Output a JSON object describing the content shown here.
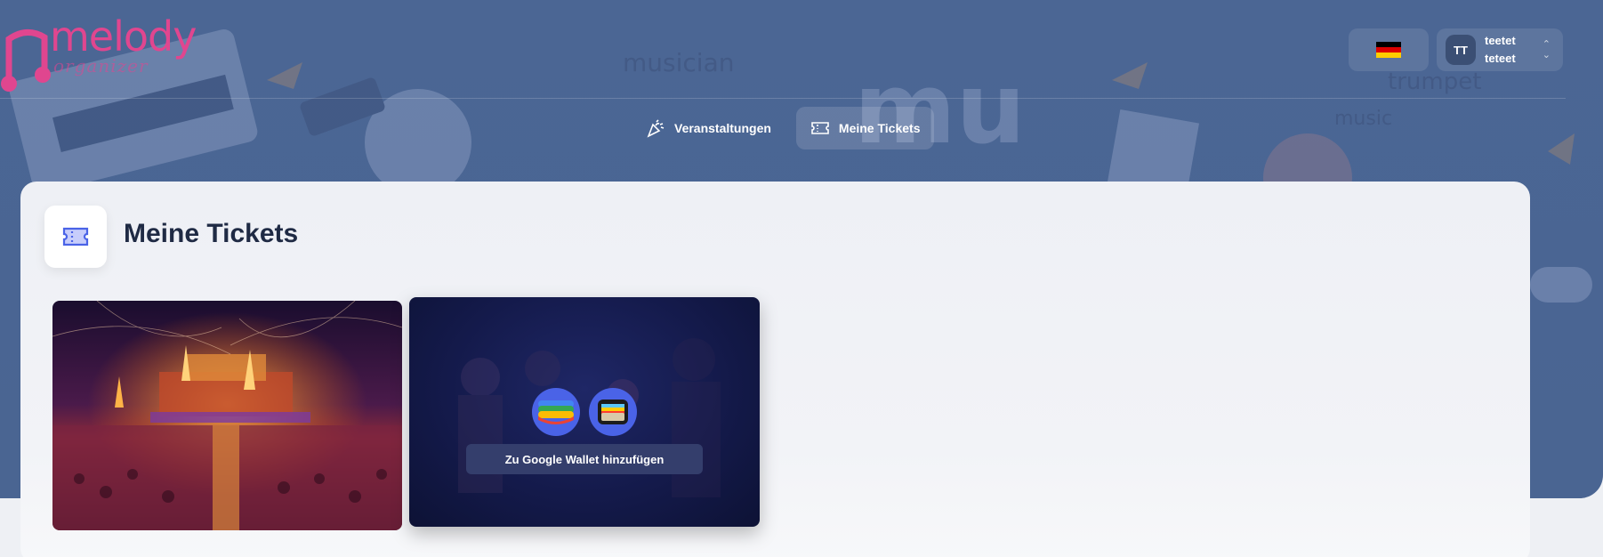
{
  "brand": {
    "name": "melody",
    "subtitle": "organizer"
  },
  "header": {
    "language": {
      "flag_colors": [
        "#000000",
        "#dd0000",
        "#ffce00"
      ]
    },
    "user": {
      "initials": "TT",
      "first_name": "teetet",
      "last_name": "teteet"
    }
  },
  "nav": {
    "items": [
      {
        "label": "Veranstaltungen",
        "icon": "party-popper-icon",
        "active": false
      },
      {
        "label": "Meine Tickets",
        "icon": "ticket-icon",
        "active": true
      }
    ]
  },
  "main": {
    "title": "Meine Tickets",
    "tickets": [
      {
        "wallet_button_label": "Zu Google Wallet hinzufügen"
      }
    ]
  },
  "colors": {
    "accent": "#4a63e7",
    "brand_pink": "#e0468f",
    "title_text": "#1f2a44",
    "hero_bg": "#4b6694"
  }
}
